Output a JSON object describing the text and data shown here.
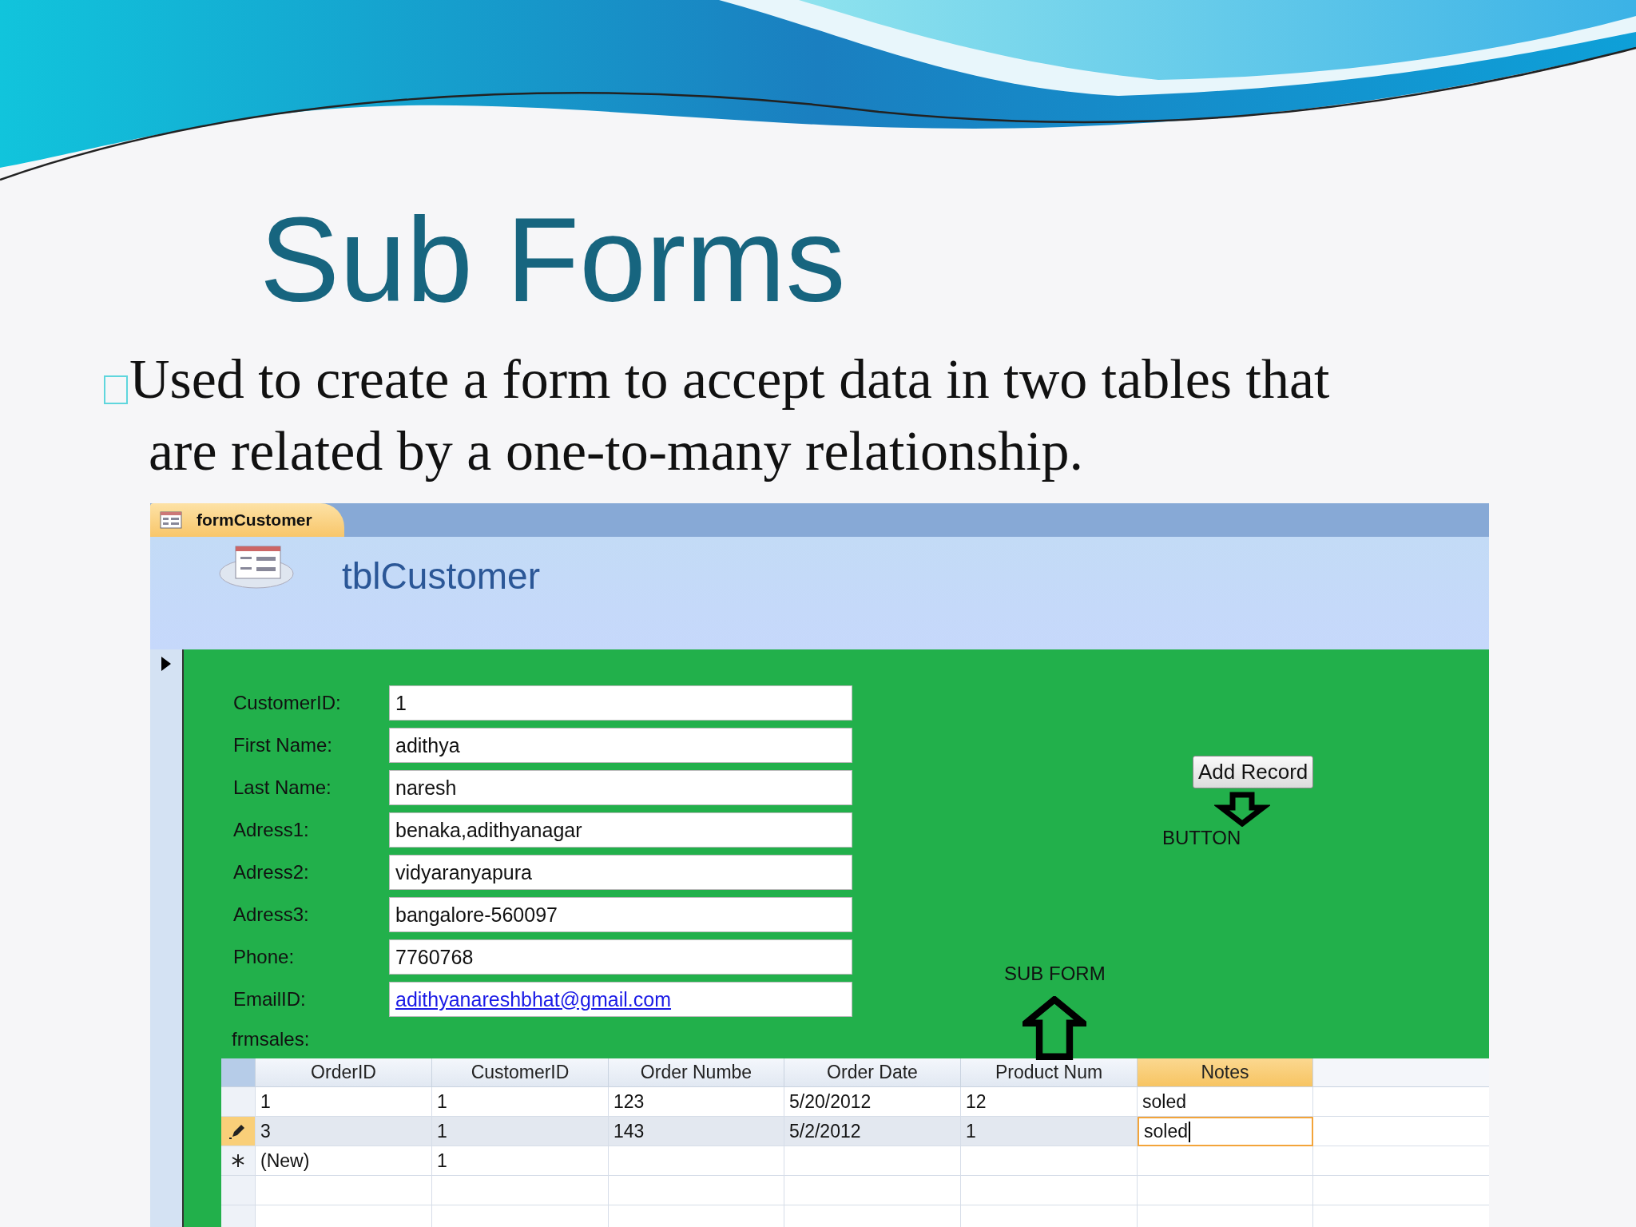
{
  "slide": {
    "title": "Sub Forms",
    "bullet_lines": [
      "Used to create a form to accept data in two tables that",
      "are related by a one-to-many relationship."
    ]
  },
  "window": {
    "tab": "formCustomer",
    "header": "tblCustomer",
    "fields": [
      {
        "label": "CustomerID:",
        "value": "1",
        "kind": "text"
      },
      {
        "label": "First Name:",
        "value": "adithya",
        "kind": "text"
      },
      {
        "label": "Last Name:",
        "value": "naresh",
        "kind": "text"
      },
      {
        "label": "Adress1:",
        "value": "benaka,adithyanagar",
        "kind": "text"
      },
      {
        "label": "Adress2:",
        "value": "vidyaranyapura",
        "kind": "text"
      },
      {
        "label": "Adress3:",
        "value": "bangalore-560097",
        "kind": "text"
      },
      {
        "label": "Phone:",
        "value": "7760768",
        "kind": "text"
      },
      {
        "label": "EmailID:",
        "value": "adithyanareshbhat@gmail.com",
        "kind": "link"
      }
    ],
    "button": "Add Record",
    "annotations": [
      {
        "text": "BUTTON",
        "kind": "down"
      },
      {
        "text": "SUB FORM",
        "kind": "up"
      }
    ],
    "subform": {
      "label": "frmsales:",
      "columns": [
        {
          "label": "OrderID",
          "selected": false
        },
        {
          "label": "CustomerID",
          "selected": false
        },
        {
          "label": "Order Numbe",
          "selected": false
        },
        {
          "label": "Order Date",
          "selected": false
        },
        {
          "label": "Product Num",
          "selected": false
        },
        {
          "label": "Notes",
          "selected": true
        }
      ],
      "rows": [
        {
          "kind": "record",
          "selected": false,
          "cells": [
            "1",
            "1",
            "123",
            "5/20/2012",
            "12",
            "soled"
          ]
        },
        {
          "kind": "editing",
          "selected": true,
          "cells": [
            "3",
            "1",
            "143",
            "5/2/2012",
            "1",
            "soled"
          ]
        },
        {
          "kind": "new",
          "selected": false,
          "cells": [
            "(New)",
            "1",
            "",
            "",
            "",
            ""
          ]
        }
      ]
    }
  }
}
